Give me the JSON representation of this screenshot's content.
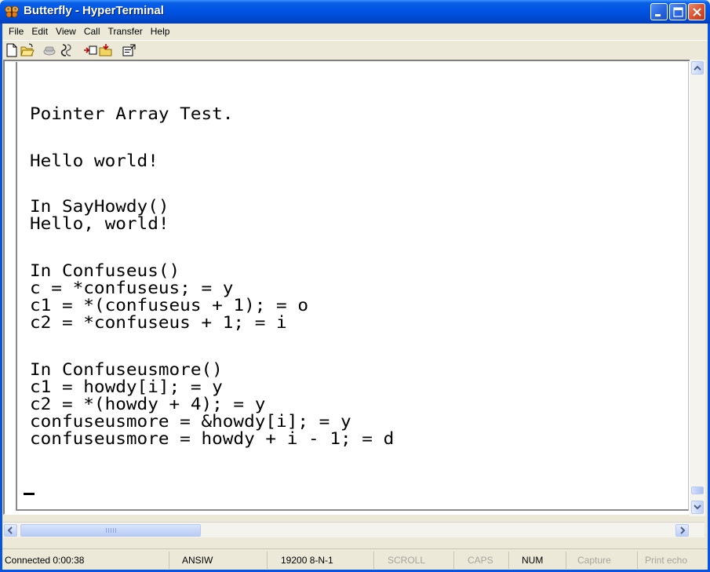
{
  "window": {
    "title": "Butterfly - HyperTerminal",
    "icon": "hyperterminal-butterfly-icon",
    "controls": {
      "minimize": "minimize-icon",
      "maximize": "maximize-icon",
      "close": "close-icon"
    }
  },
  "menu": {
    "items": [
      {
        "label": "File"
      },
      {
        "label": "Edit"
      },
      {
        "label": "View"
      },
      {
        "label": "Call"
      },
      {
        "label": "Transfer"
      },
      {
        "label": "Help"
      }
    ]
  },
  "toolbar": {
    "icons": [
      "new-document-icon",
      "open-folder-icon",
      "call-icon",
      "disconnect-icon",
      "send-icon",
      "receive-icon",
      "properties-icon"
    ]
  },
  "terminal": {
    "lines": [
      "Pointer Array Test.",
      "",
      "Hello world!",
      "",
      "In SayHowdy()",
      "Hello, world!",
      "",
      "In Confuseus()",
      "c = *confuseus; = y",
      "c1 = *(confuseus + 1); = o",
      "c2 = *confuseus + 1; = i",
      "",
      "In Confuseusmore()",
      "c1 = howdy[i]; = y",
      "c2 = *(howdy + 4); = y",
      "confuseusmore = &howdy[i]; = y",
      "confuseusmore = howdy + i - 1; = d"
    ],
    "cursor": "_"
  },
  "status": {
    "connected": "Connected 0:00:38",
    "emulation": "ANSIW",
    "settings": "19200 8-N-1",
    "scroll": "SCROLL",
    "caps": "CAPS",
    "num": "NUM",
    "capture": "Capture",
    "print_echo": "Print echo"
  },
  "colors": {
    "titlebar": "#0054e3",
    "close_button": "#d9502e",
    "terminal_bg": "#ffffff"
  }
}
